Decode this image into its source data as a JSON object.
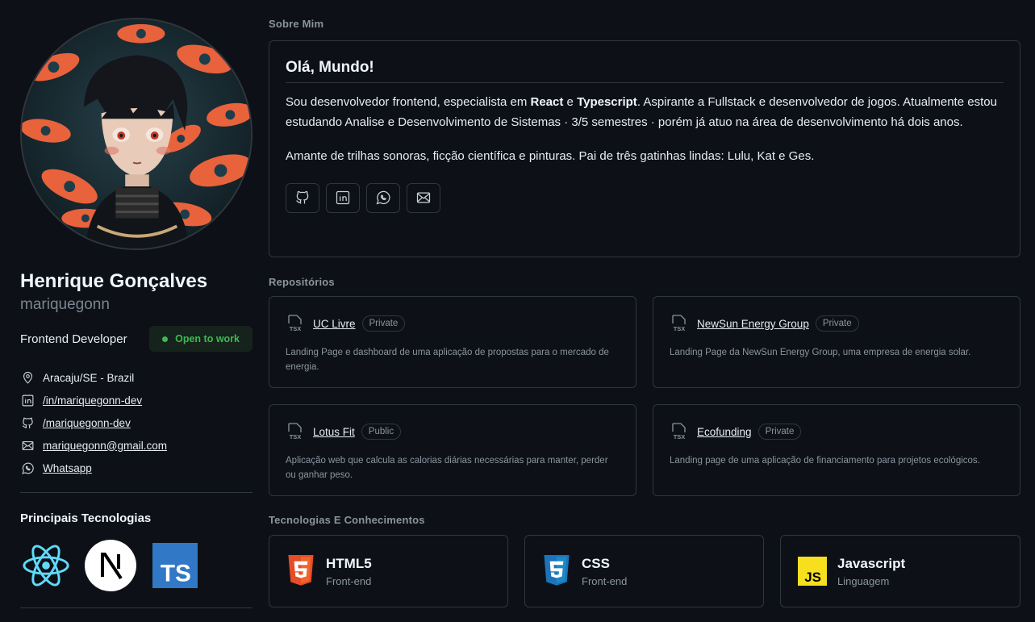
{
  "profile": {
    "name": "Henrique Gonçalves",
    "username": "mariquegonn",
    "role": "Frontend Developer",
    "status": "Open to work",
    "contacts": [
      {
        "icon": "location-icon",
        "text": "Aracaju/SE - Brazil"
      },
      {
        "icon": "linkedin-icon",
        "text": "/in/mariquegonn-dev"
      },
      {
        "icon": "github-icon",
        "text": "/mariquegonn-dev"
      },
      {
        "icon": "mail-icon",
        "text": "mariquegonn@gmail.com"
      },
      {
        "icon": "whatsapp-icon",
        "text": "Whatsapp"
      }
    ],
    "tech_title": "Principais Tecnologias",
    "tech_logos": [
      "react-logo",
      "nextjs-logo",
      "typescript-logo"
    ]
  },
  "about": {
    "section_title": "Sobre Mim",
    "heading": "Olá, Mundo!",
    "p1_a": "Sou desenvolvedor frontend, especialista em ",
    "p1_react": "React",
    "p1_e": " e ",
    "p1_ts": "Typescript",
    "p1_b": ". Aspirante a Fullstack e desenvolvedor de jogos. Atualmente estou estudando Analise e Desenvolvimento de Sistemas · 3/5 semestres · porém já atuo na área de desenvolvimento há dois anos.",
    "p2": "Amante de trilhas sonoras, ficção científica e pinturas. Pai de três gatinhas lindas: Lulu, Kat e Ges.",
    "social_icons": [
      "github-icon",
      "linkedin-icon",
      "whatsapp-icon",
      "mail-icon"
    ]
  },
  "repos": {
    "section_title": "Repositórios",
    "items": [
      {
        "name": "UC Livre",
        "visibility": "Private",
        "description": "Landing Page e dashboard de uma aplicação de propostas para o mercado de energia."
      },
      {
        "name": "NewSun Energy Group",
        "visibility": "Private",
        "description": "Landing Page da NewSun Energy Group, uma empresa de energia solar."
      },
      {
        "name": "Lotus Fit",
        "visibility": "Public",
        "description": "Aplicação web que calcula as calorias diárias necessárias para manter, perder ou ganhar peso."
      },
      {
        "name": "Ecofunding",
        "visibility": "Private",
        "description": "Landing page de uma aplicação de financiamento para projetos ecológicos."
      }
    ],
    "tsx_label": "TSX"
  },
  "tech": {
    "section_title": "Tecnologias E Conhecimentos",
    "items": [
      {
        "name": "HTML5",
        "category": "Front-end",
        "icon": "html5-icon"
      },
      {
        "name": "CSS",
        "category": "Front-end",
        "icon": "css3-icon"
      },
      {
        "name": "Javascript",
        "category": "Linguagem",
        "icon": "javascript-icon"
      }
    ]
  },
  "colors": {
    "background": "#0d1117",
    "border": "#30363d",
    "muted": "#8b949e",
    "open_to_work": "#3fb950"
  }
}
